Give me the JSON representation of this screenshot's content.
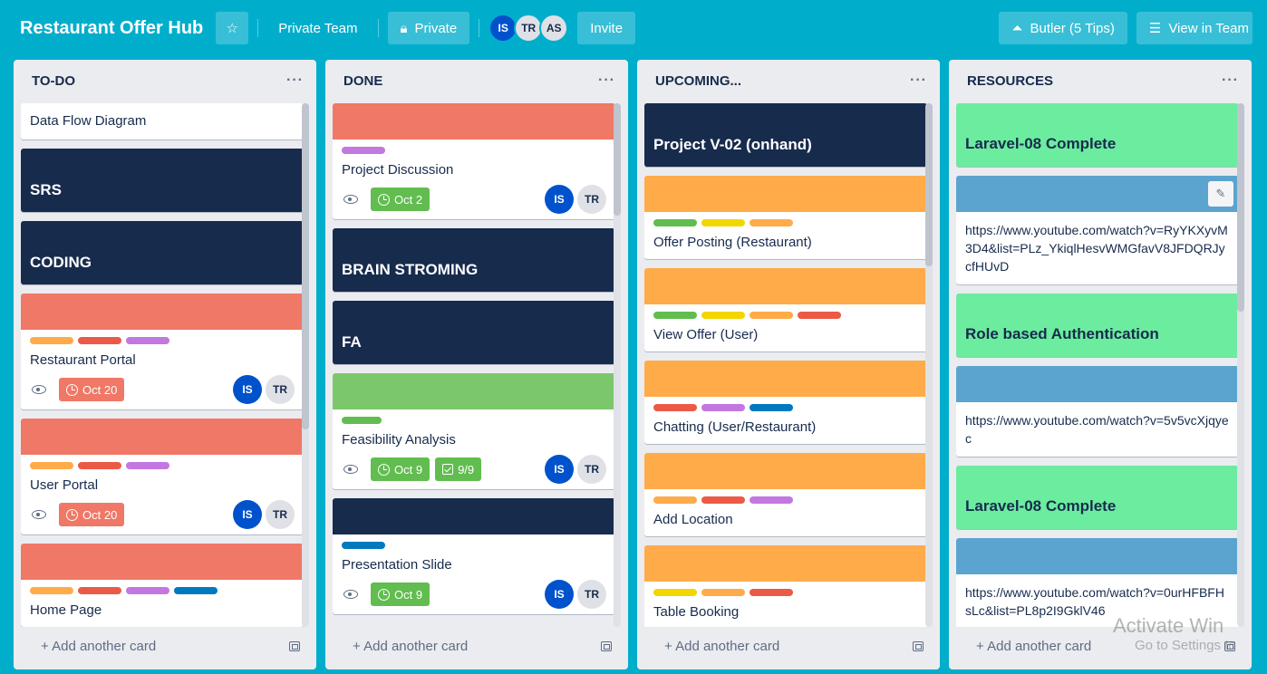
{
  "topbar": {
    "board_title": "Restaurant Offer Hub",
    "team": "Private Team",
    "visibility": "Private",
    "members": [
      {
        "initials": "IS",
        "bg": "#0052cc",
        "fg": "#ffffff"
      },
      {
        "initials": "TR",
        "bg": "#dfe1e6",
        "fg": "#172b4d"
      },
      {
        "initials": "AS",
        "bg": "#dfe1e6",
        "fg": "#172b4d"
      }
    ],
    "invite": "Invite",
    "butler": "Butler (5 Tips)",
    "view": "View in Team"
  },
  "lists": {
    "todo": {
      "title": "TO-DO",
      "menu": "···",
      "add_card": "+ Add another card",
      "cards": {
        "c1": {
          "title": "Data Flow Diagram"
        },
        "c2": {
          "title": "SRS"
        },
        "c3": {
          "title": "CODING"
        },
        "c4": {
          "title": "Restaurant Portal",
          "due": "Oct 20"
        },
        "c5": {
          "title": "User Portal",
          "due": "Oct 20"
        },
        "c6": {
          "title": "Home Page"
        }
      }
    },
    "done": {
      "title": "DONE",
      "menu": "···",
      "add_card": "+ Add another card",
      "cards": {
        "c1": {
          "title": "Project Discussion",
          "due": "Oct 2"
        },
        "c2": {
          "title": "BRAIN STROMING"
        },
        "c3": {
          "title": "FA"
        },
        "c4": {
          "title": "Feasibility Analysis",
          "due": "Oct 9",
          "checklist": "9/9"
        },
        "c5": {
          "title": "Presentation Slide",
          "due": "Oct 9"
        }
      }
    },
    "upcoming": {
      "title": "UPCOMING...",
      "menu": "···",
      "add_card": "+ Add another card",
      "cards": {
        "c1": {
          "title": "Project V-02 (onhand)"
        },
        "c2": {
          "title": "Offer Posting (Restaurant)"
        },
        "c3": {
          "title": "View Offer (User)"
        },
        "c4": {
          "title": "Chatting (User/Restaurant)"
        },
        "c5": {
          "title": "Add Location"
        },
        "c6": {
          "title": "Table Booking"
        }
      }
    },
    "resources": {
      "title": "RESOURCES",
      "menu": "···",
      "add_card": "+ Add another card",
      "cards": {
        "c1": {
          "title": "Laravel-08 Complete"
        },
        "c2": {
          "link": "https://www.youtube.com/watch?v=RyYKXyvM3D4&list=PLz_YkiqlHesvWMGfavV8JFDQRJycfHUvD"
        },
        "c3": {
          "title": "Role based Authentication"
        },
        "c4": {
          "link": "https://www.youtube.com/watch?v=5v5vcXjqyec"
        },
        "c5": {
          "title": "Laravel-08 Complete"
        },
        "c6": {
          "link": "https://www.youtube.com/watch?v=0urHFBFHsLc&list=PL8p2I9GklV46"
        }
      }
    }
  },
  "card_members": {
    "is": "IS",
    "tr": "TR"
  },
  "watermark": {
    "line1": "Activate Win",
    "line2": "Go to Settings to"
  },
  "colors": {
    "board_bg": "#00aecc",
    "dark_cover": "#172b4d",
    "red": "#eb5a46",
    "salmon": "#f07866",
    "orange": "#ffab4a",
    "green": "#61bd4f",
    "purple": "#c377e0",
    "blue": "#0079bf",
    "yellow": "#f2d600",
    "mint": "#6bec9f",
    "steel": "#5ba4cf"
  }
}
